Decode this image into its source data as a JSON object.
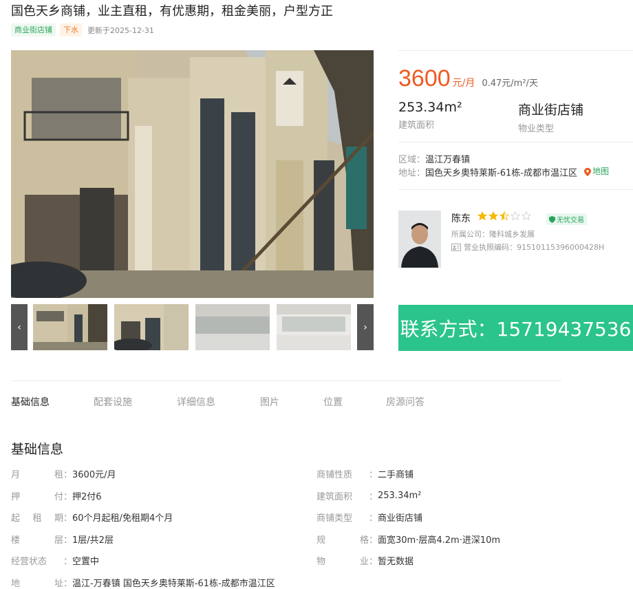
{
  "title": "国色天乡商铺，业主直租，有优惠期，租金美丽，户型方正",
  "tags": [
    "商业街店铺",
    "下水"
  ],
  "update_text": "更新于2025-12-31",
  "price": {
    "value": "3600",
    "unit": "元/月",
    "unit_price": "0.47元/m²/天"
  },
  "stats": [
    {
      "value": "253.34m²",
      "label": "建筑面积"
    },
    {
      "value": "商业街店铺",
      "label": "物业类型"
    }
  ],
  "location": {
    "area_label": "区域：",
    "area": "温江万春镇",
    "addr_label": "地址：",
    "addr": "国色天乡奥特莱斯-61栋-成都市温江区",
    "map_link": "地图"
  },
  "agent": {
    "name": "陈东",
    "rating": 2.5,
    "rating_max": 5,
    "badge": "无忧交易",
    "company": "所属公司：隆科城乡发展",
    "license": "营业执照编码：91510115396000428H"
  },
  "contact": "联系方式：15719437536",
  "nav": [
    "基础信息",
    "配套设施",
    "详细信息",
    "图片",
    "位置",
    "房源问答"
  ],
  "section_title": "基础信息",
  "info_left": [
    {
      "label": "月租",
      "value": "3600元/月"
    },
    {
      "label": "押付",
      "value": "押2付6"
    },
    {
      "label": "起租期",
      "value": "60个月起租/免租期4个月"
    },
    {
      "label": "楼层",
      "value": "1层/共2层"
    },
    {
      "label": "经营状态",
      "value": "空置中"
    },
    {
      "label": "地址",
      "value": "温江-万春镇 国色天乡奥特莱斯-61栋-成都市温江区"
    }
  ],
  "info_right": [
    {
      "label": "商铺性质",
      "value": "二手商铺"
    },
    {
      "label": "建筑面积",
      "value": "253.34m²"
    },
    {
      "label": "商铺类型",
      "value": "商业街店铺"
    },
    {
      "label": "规格",
      "value": "面宽30m·层高4.2m·进深10m"
    },
    {
      "label": "物业",
      "value": "暂无数据"
    }
  ],
  "icons": {
    "prev": "chevron-left-icon",
    "next": "chevron-right-icon",
    "map": "map-pin-icon",
    "badge": "shield-icon",
    "license": "id-card-icon",
    "star": "star-icon"
  },
  "colors": {
    "accent_orange": "#f05a22",
    "accent_green": "#2bc48a",
    "tag_green": "#2aa55c",
    "tag_orange": "#ee7d31"
  }
}
